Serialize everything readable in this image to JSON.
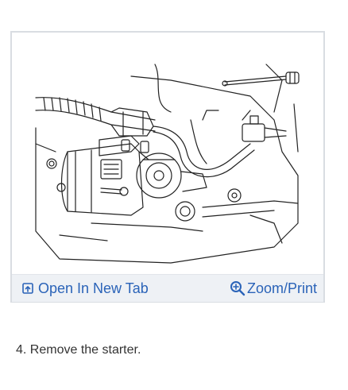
{
  "figure": {
    "open_tab_label": "Open In New Tab",
    "zoom_label": "Zoom/Print",
    "open_tab_icon": "open-in-new-tab-icon",
    "zoom_icon": "zoom-in-icon"
  },
  "step": {
    "text": "4. Remove the starter."
  },
  "colors": {
    "link": "#2a63b8",
    "toolbar_bg": "#eef1f5",
    "border": "#d9dde2"
  }
}
